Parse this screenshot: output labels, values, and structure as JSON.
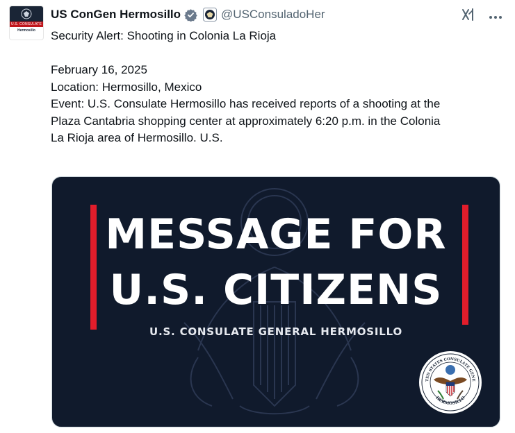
{
  "account": {
    "display_name": "US ConGen Hermosillo",
    "handle": "@USConsuladoHer",
    "avatar_band_text": "U.S. CONSULATE",
    "avatar_city_text": "Hermosillo"
  },
  "icons": {
    "verified": "verified-badge-icon",
    "affiliate": "government-seal-icon",
    "grok": "grok-icon",
    "more": "more-options-icon"
  },
  "post": {
    "title": "Security Alert: Shooting in Colonia La Rioja",
    "date": "February 16, 2025",
    "location": "Location:  Hermosillo, Mexico",
    "event_line1": "Event: U.S. Consulate Hermosillo has received reports of a shooting at the",
    "event_line2": "Plaza Cantabria shopping center at approximately 6:20 p.m. in the Colonia",
    "event_line3": "La Rioja area of Hermosillo.  U.S."
  },
  "media": {
    "headline_line1": "MESSAGE FOR",
    "headline_line2": "U.S. CITIZENS",
    "subheading": "U.S. CONSULATE GENERAL HERMOSILLO",
    "seal_top_text": "UNITED STATES CONSULATE GENERAL",
    "seal_bottom_text": "HERMOSILLO"
  },
  "colors": {
    "verified_blue": "#1d9bf0",
    "media_background": "#101a2c",
    "accent_red": "#e21d2b"
  }
}
